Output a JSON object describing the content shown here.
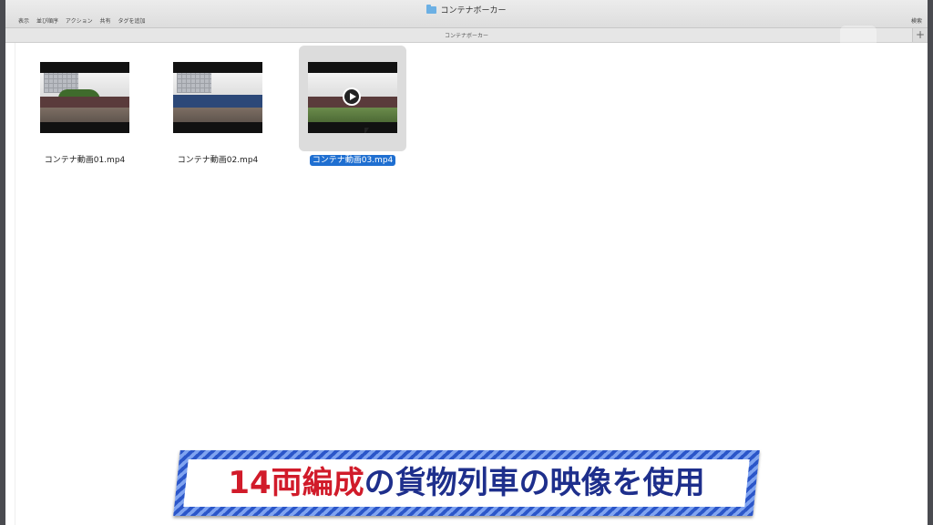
{
  "window": {
    "title": "コンテナボーカー",
    "path_title": "コンテナボーカー",
    "toolbar": [
      "表示",
      "並び順序",
      "アクション",
      "共有",
      "タグを追加"
    ],
    "search_label": "検索",
    "add_tab": "+"
  },
  "files": [
    {
      "name": "コンテナ動画01.mp4",
      "selected": false
    },
    {
      "name": "コンテナ動画02.mp4",
      "selected": false
    },
    {
      "name": "コンテナ動画03.mp4",
      "selected": true
    }
  ],
  "caption": {
    "part1": "14両編成",
    "part2": "の貨物列車の映像を使用",
    "color_primary": "#d11b2a",
    "color_secondary": "#1e2f8c"
  },
  "colors": {
    "selection": "#1f6fd1"
  }
}
